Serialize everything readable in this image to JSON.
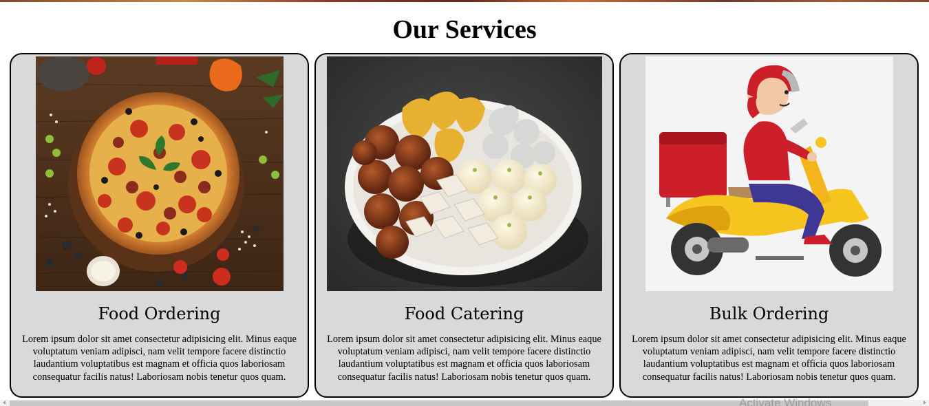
{
  "page": {
    "title": "Our Services"
  },
  "services": [
    {
      "title": "Food Ordering",
      "description": "Lorem ipsum dolor sit amet consectetur adipisicing elit. Minus eaque voluptatum veniam adipisci, nam velit tempore facere distinctio laudantium voluptatibus est magnam et officia quos laboriosam consequatur facilis natus! Laboriosam nobis tenetur quos quam."
    },
    {
      "title": "Food Catering",
      "description": "Lorem ipsum dolor sit amet consectetur adipisicing elit. Minus eaque voluptatum veniam adipisci, nam velit tempore facere distinctio laudantium voluptatibus est magnam et officia quos laboriosam consequatur facilis natus! Laboriosam nobis tenetur quos quam."
    },
    {
      "title": "Bulk Ordering",
      "description": "Lorem ipsum dolor sit amet consectetur adipisicing elit. Minus eaque voluptatum veniam adipisci, nam velit tempore facere distinctio laudantium voluptatibus est magnam et officia quos laboriosam consequatur facilis natus! Laboriosam nobis tenetur quos quam."
    }
  ],
  "watermark": {
    "text": "Activate Windows"
  }
}
